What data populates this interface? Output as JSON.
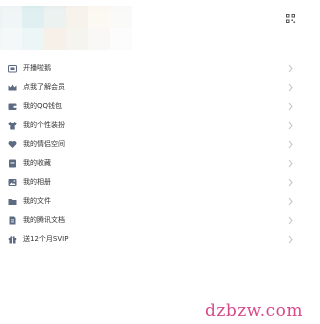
{
  "menu": {
    "items": [
      {
        "label": "开播啦鹅",
        "icon": "tv-icon"
      },
      {
        "label": "点我了解会员",
        "icon": "crown-icon"
      },
      {
        "label": "我的QQ钱包",
        "icon": "wallet-icon"
      },
      {
        "label": "我的个性装扮",
        "icon": "shirt-icon"
      },
      {
        "label": "我的情侣空间",
        "icon": "heart-icon"
      },
      {
        "label": "我的收藏",
        "icon": "bookmark-icon"
      },
      {
        "label": "我的相册",
        "icon": "photo-album-icon"
      },
      {
        "label": "我的文件",
        "icon": "folder-icon"
      },
      {
        "label": "我的腾讯文档",
        "icon": "document-icon"
      },
      {
        "label": "送12个月SVIP",
        "icon": "gift-icon"
      }
    ]
  },
  "header": {
    "qr_icon": "qr-code-icon"
  },
  "watermark": {
    "text": "dzbzw.com"
  },
  "colors": {
    "icon": "#5c6a82",
    "chevron": "#bfc4cc",
    "watermark": "#d64a8a"
  }
}
